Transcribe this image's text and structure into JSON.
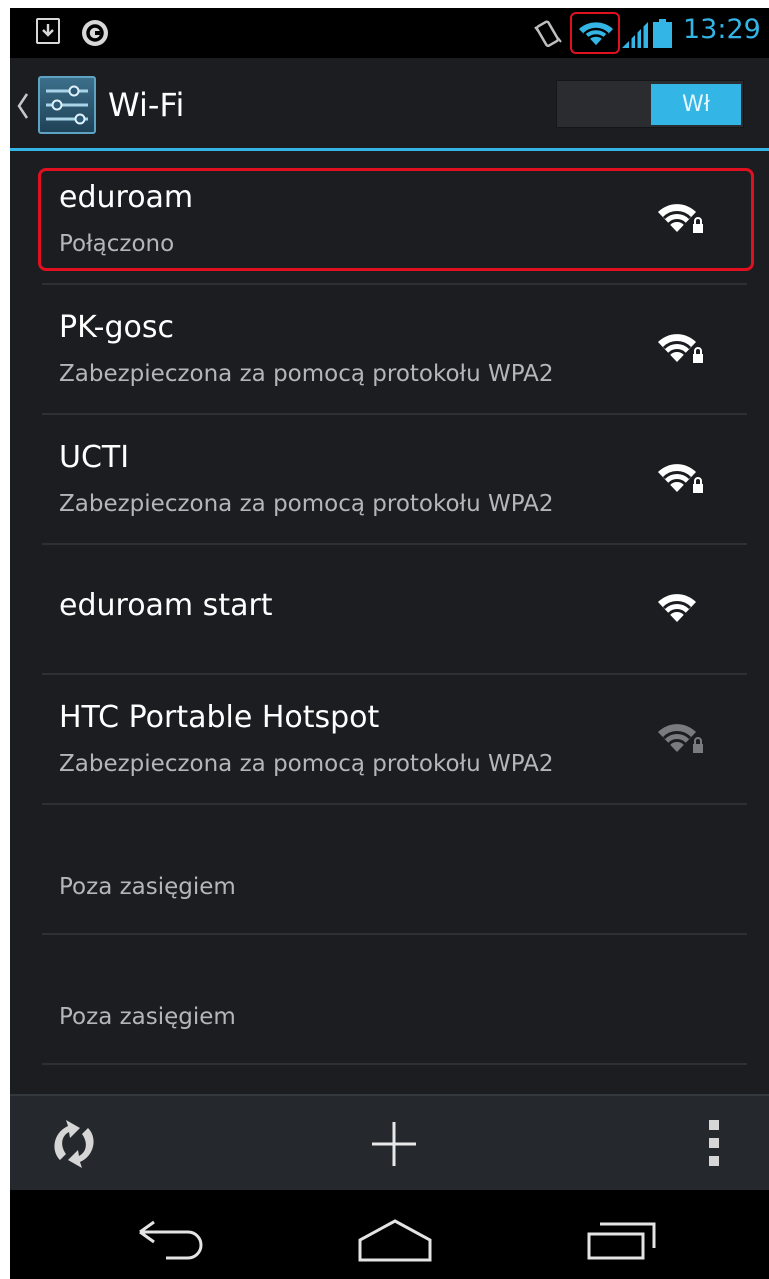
{
  "status_bar": {
    "time": "13:29",
    "icons": [
      "download-icon",
      "circle-app-icon",
      "vibrate-icon",
      "wifi-icon",
      "signal-icon",
      "battery-icon"
    ],
    "highlight_color": "#e01020",
    "accent": "#33b5e5"
  },
  "action_bar": {
    "title": "Wi-Fi",
    "toggle_label": "Wł",
    "icons": [
      "back-chevron-icon",
      "settings-sliders-icon"
    ]
  },
  "networks": [
    {
      "name": "eduroam",
      "status": "Połączono",
      "secured": true,
      "signal": "strong",
      "highlighted": true
    },
    {
      "name": "PK-gosc",
      "status": "Zabezpieczona za pomocą protokołu WPA2",
      "secured": true,
      "signal": "strong"
    },
    {
      "name": "UCTI",
      "status": "Zabezpieczona za pomocą protokołu WPA2",
      "secured": true,
      "signal": "strong"
    },
    {
      "name": "eduroam start",
      "status": "",
      "secured": false,
      "signal": "strong"
    },
    {
      "name": "HTC Portable Hotspot",
      "status": "Zabezpieczona za pomocą protokołu WPA2",
      "secured": true,
      "signal": "weak"
    }
  ],
  "out_of_range": [
    {
      "label": "Poza zasięgiem"
    },
    {
      "label": "Poza zasięgiem"
    }
  ],
  "toolbar": {
    "icons": [
      "scan-refresh-icon",
      "add-network-icon",
      "overflow-menu-icon"
    ]
  },
  "nav_bar": {
    "icons": [
      "back-icon",
      "home-icon",
      "recents-icon"
    ]
  }
}
